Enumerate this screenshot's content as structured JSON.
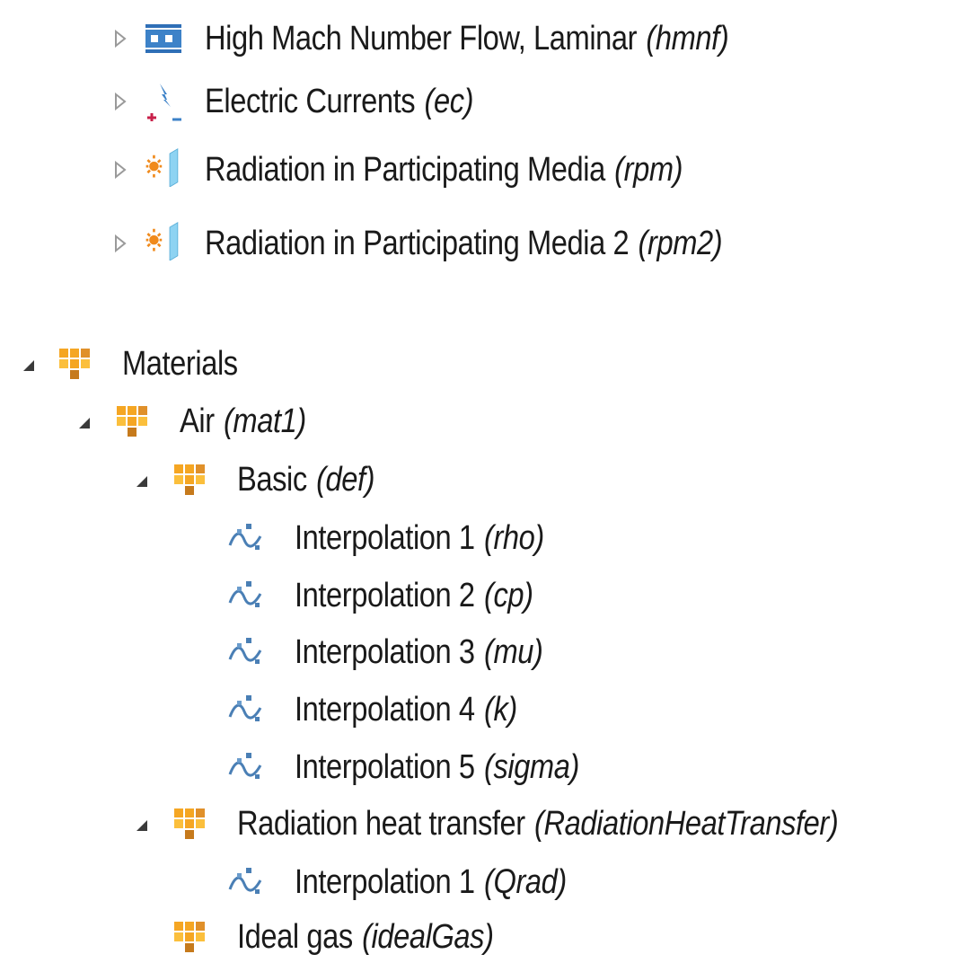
{
  "tree": {
    "physics": [
      {
        "label": "High Mach Number Flow, Laminar",
        "tag": "(hmnf)",
        "icon": "high-mach-flow-icon",
        "expanded": false
      },
      {
        "label": "Electric Currents",
        "tag": "(ec)",
        "icon": "electric-currents-icon",
        "expanded": false
      },
      {
        "label": "Radiation in Participating Media",
        "tag": "(rpm)",
        "icon": "radiation-media-icon",
        "expanded": false
      },
      {
        "label": "Radiation in Participating Media 2",
        "tag": "(rpm2)",
        "icon": "radiation-media-icon",
        "expanded": false
      }
    ],
    "materials": {
      "label": "Materials",
      "icon": "materials-icon",
      "expanded": true,
      "air": {
        "label": "Air",
        "tag": "(mat1)",
        "expanded": true,
        "basic": {
          "label": "Basic",
          "tag": "(def)",
          "expanded": true,
          "items": [
            {
              "label": "Interpolation 1",
              "tag": "(rho)"
            },
            {
              "label": "Interpolation 2",
              "tag": "(cp)"
            },
            {
              "label": "Interpolation 3",
              "tag": "(mu)"
            },
            {
              "label": "Interpolation 4",
              "tag": "(k)"
            },
            {
              "label": "Interpolation 5",
              "tag": "(sigma)"
            }
          ]
        },
        "radiation": {
          "label": "Radiation heat transfer",
          "tag": "(RadiationHeatTransfer)",
          "expanded": true,
          "items": [
            {
              "label": "Interpolation 1",
              "tag": "(Qrad)"
            }
          ]
        },
        "ideal_gas": {
          "label": "Ideal gas",
          "tag": "(idealGas)"
        }
      }
    }
  },
  "colors": {
    "text": "#1a1a1a",
    "material_orange": "#f5a623",
    "material_dark": "#c67a1c",
    "interp_blue": "#4a7fb5",
    "flow_blue": "#2f6fb7",
    "radiation_cyan": "#8ed3f2",
    "toggle_grey": "#9a9a9a"
  }
}
